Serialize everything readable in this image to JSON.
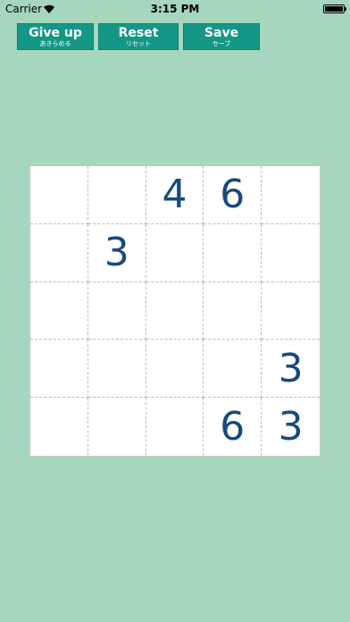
{
  "status_bar": {
    "carrier": "Carrier",
    "time": "3:15 PM",
    "battery_level": 1.0
  },
  "toolbar": {
    "give_up": {
      "label": "Give up",
      "sub": "あきらめる"
    },
    "reset": {
      "label": "Reset",
      "sub": "リセット"
    },
    "save": {
      "label": "Save",
      "sub": "セーブ"
    }
  },
  "board": {
    "size": 5,
    "cells": [
      [
        "",
        "",
        "4",
        "6",
        ""
      ],
      [
        "",
        "3",
        "",
        "",
        ""
      ],
      [
        "",
        "",
        "",
        "",
        ""
      ],
      [
        "",
        "",
        "",
        "",
        "3"
      ],
      [
        "",
        "",
        "",
        "6",
        "3"
      ]
    ]
  },
  "colors": {
    "background": "#a6d6bd",
    "button": "#159787",
    "digit": "#174a7c"
  }
}
